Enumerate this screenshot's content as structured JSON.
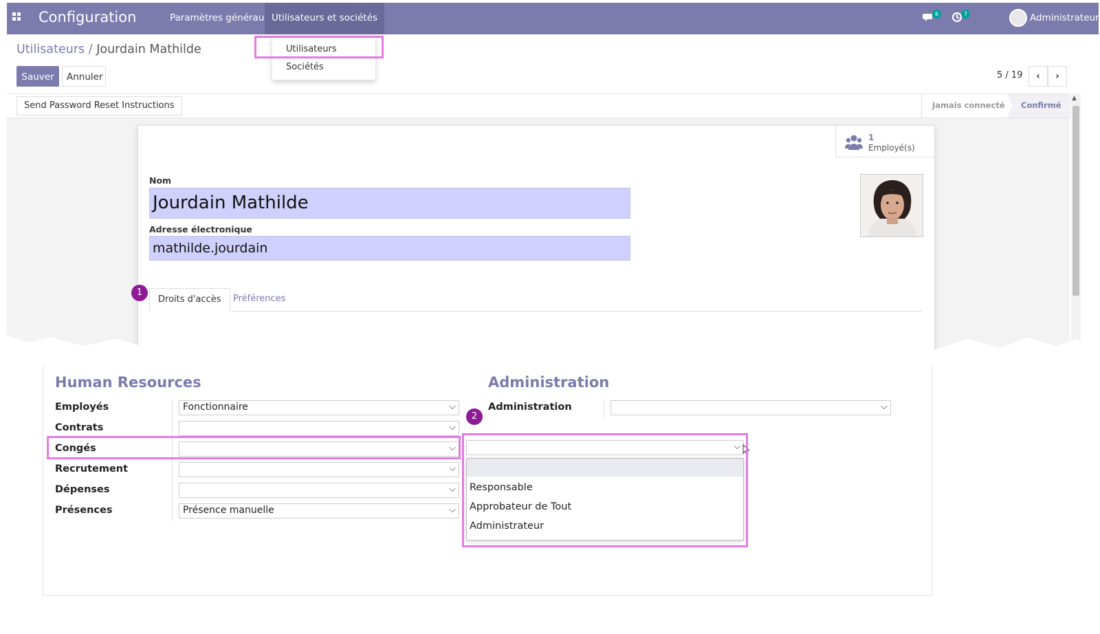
{
  "navbar": {
    "app_title": "Configuration",
    "menu_general": "Paramètres généraux",
    "menu_users": "Utilisateurs et sociétés",
    "messages_count": "6",
    "activities_count": "7",
    "user_name": "Administrateur"
  },
  "dropdown": {
    "items": [
      "Utilisateurs",
      "Sociétés"
    ]
  },
  "breadcrumb": {
    "parent": "Utilisateurs",
    "separator": "/",
    "current": "Jourdain Mathilde"
  },
  "actions": {
    "save": "Sauver",
    "discard": "Annuler",
    "reset_password": "Send Password Reset Instructions"
  },
  "pager": {
    "value": "5 / 19"
  },
  "status": {
    "stages": [
      "Jamais connecté",
      "Confirmé"
    ],
    "active": "Confirmé"
  },
  "stat_button": {
    "count": "1",
    "label": "Employé(s)"
  },
  "form": {
    "name_label": "Nom",
    "name_value": "Jourdain Mathilde",
    "email_label": "Adresse électronique",
    "email_value": "mathilde.jourdain"
  },
  "tabs": [
    "Droits d'accès",
    "Préférences"
  ],
  "steps": [
    "1",
    "2"
  ],
  "hr_section": {
    "title": "Human Resources",
    "rows": [
      {
        "label": "Employés",
        "value": "Fonctionnaire"
      },
      {
        "label": "Contrats",
        "value": ""
      },
      {
        "label": "Congés",
        "value": ""
      },
      {
        "label": "Recrutement",
        "value": ""
      },
      {
        "label": "Dépenses",
        "value": ""
      },
      {
        "label": "Présences",
        "value": "Présence manuelle"
      }
    ]
  },
  "admin_section": {
    "title": "Administration",
    "label": "Administration",
    "value": ""
  },
  "open_select": {
    "value": "",
    "options": [
      "Responsable",
      "Approbateur de Tout",
      "Administrateur"
    ]
  },
  "colors": {
    "brand": "#7c7bad",
    "input_highlight": "#cfd0fb",
    "annotation_box": "#e47ae4",
    "step_badge": "#8e1a96"
  }
}
